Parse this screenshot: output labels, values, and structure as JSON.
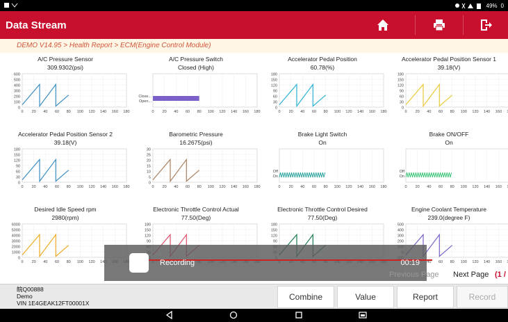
{
  "status_bar": {
    "battery": "49%",
    "time": "0"
  },
  "header": {
    "title": "Data Stream"
  },
  "breadcrumb": "DEMO V14.95 > Health Report > ECM(Engine Control Module)",
  "colors": {
    "brand_red": "#c8102e",
    "blue": "#3b8fc4",
    "cyan": "#2bb2d4",
    "yellow": "#e8c93a",
    "brown": "#a88060",
    "teal": "#20a09a",
    "green": "#30c070",
    "orange": "#eeaa22",
    "crimson": "#e0506a",
    "darkgreen": "#1d7a50",
    "purple": "#7a60c8"
  },
  "x_ticks": [
    "0",
    "20",
    "40",
    "60",
    "80",
    "100",
    "120",
    "140",
    "160",
    "180"
  ],
  "charts": [
    {
      "title": "A/C Pressure Sensor",
      "value": "309.9302(psi)",
      "type": "saw",
      "color": "blue",
      "y_ticks": [
        "600",
        "500",
        "400",
        "300",
        "200",
        "100",
        "0"
      ]
    },
    {
      "title": "A/C Pressure Switch",
      "value": "Closed (High)",
      "type": "bar",
      "color": "purple",
      "y_ticks": [
        "Close...",
        "Open..."
      ]
    },
    {
      "title": "Accelerator Pedal Position",
      "value": "60.78(%)",
      "type": "saw",
      "color": "cyan",
      "y_ticks": [
        "180",
        "150",
        "120",
        "90",
        "60",
        "30",
        "0"
      ]
    },
    {
      "title": "Accelerator Pedal Position Sensor 1",
      "value": "39.18(V)",
      "type": "saw",
      "color": "yellow",
      "y_ticks": [
        "180",
        "150",
        "120",
        "90",
        "60",
        "30",
        "0"
      ]
    },
    {
      "title": "Accelerator Pedal Position Sensor 2",
      "value": "39.18(V)",
      "type": "saw",
      "color": "blue",
      "y_ticks": [
        "180",
        "150",
        "120",
        "90",
        "60",
        "30",
        "0"
      ]
    },
    {
      "title": "Barometric Pressure",
      "value": "16.2675(psi)",
      "type": "saw",
      "color": "brown",
      "y_ticks": [
        "30",
        "25",
        "20",
        "15",
        "10",
        "5",
        "0"
      ]
    },
    {
      "title": "Brake Light Switch",
      "value": "On",
      "type": "osc",
      "color": "teal",
      "y_ticks": [
        "Off",
        "On"
      ]
    },
    {
      "title": "Brake ON/OFF",
      "value": "On",
      "type": "osc",
      "color": "green",
      "y_ticks": [
        "Off",
        "On"
      ]
    },
    {
      "title": "Desired Idle Speed rpm",
      "value": "2980(rpm)",
      "type": "saw",
      "color": "orange",
      "y_ticks": [
        "6000",
        "5000",
        "4000",
        "3000",
        "2000",
        "1000",
        "0"
      ]
    },
    {
      "title": "Electronic Throttle Control Actual",
      "value": "77.50(Deg)",
      "type": "saw",
      "color": "crimson",
      "y_ticks": [
        "180",
        "150",
        "120",
        "90",
        "60",
        "30",
        "0"
      ]
    },
    {
      "title": "Electronic Throttle Control Desired",
      "value": "77.50(Deg)",
      "type": "saw",
      "color": "darkgreen",
      "y_ticks": [
        "180",
        "150",
        "120",
        "90",
        "60",
        "30",
        "0"
      ]
    },
    {
      "title": "Engine Coolant Temperature",
      "value": "239.0(degree F)",
      "type": "saw",
      "color": "purple",
      "y_ticks": [
        "500",
        "400",
        "300",
        "200",
        "100",
        "0",
        "-100"
      ]
    }
  ],
  "recording": {
    "label": "Recording",
    "time": "00:19"
  },
  "pager": {
    "previous": "Previous Page",
    "next": "Next Page",
    "page": "(1 /"
  },
  "vehicle": {
    "id": "皖Q00888",
    "mode": "Demo",
    "vin": "VIN 1E4GEAK12FT00001X"
  },
  "buttons": {
    "combine": "Combine",
    "value": "Value",
    "report": "Report",
    "record": "Record"
  }
}
